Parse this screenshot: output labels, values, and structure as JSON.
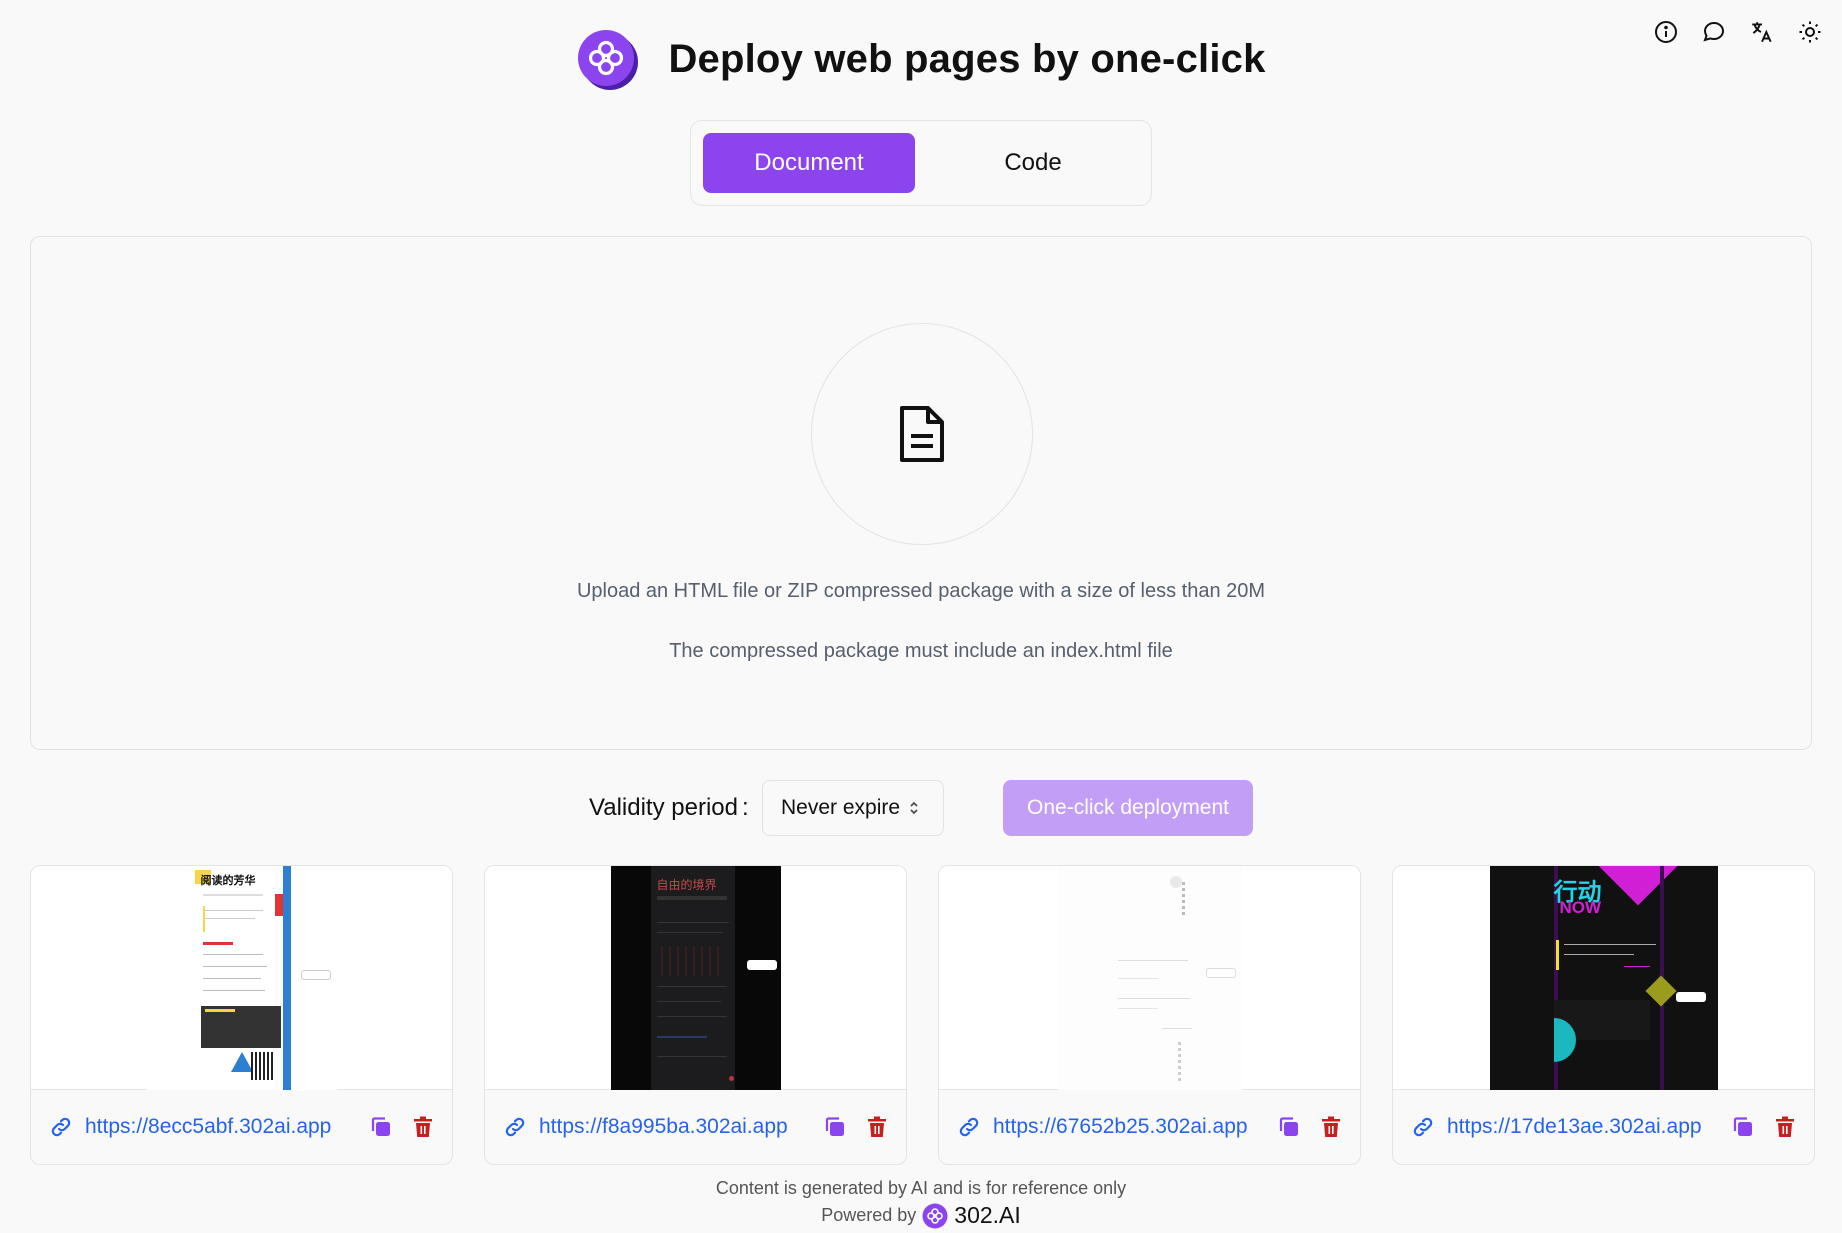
{
  "app": {
    "title": "Deploy web pages by one-click"
  },
  "top_icons": [
    "info-icon",
    "chat-icon",
    "translate-icon",
    "theme-icon"
  ],
  "tabs": [
    {
      "label": "Document",
      "active": true
    },
    {
      "label": "Code",
      "active": false
    }
  ],
  "upload": {
    "line1": "Upload an HTML file or ZIP compressed package with a size of less than 20M",
    "line2": "The compressed package must include an index.html file",
    "icon": "file-text-icon"
  },
  "deploy": {
    "validity_label": "Validity period",
    "validity_colon": ":",
    "validity_value": "Never expire",
    "button_label": "One-click deployment"
  },
  "cards": [
    {
      "url": "https://8ecc5abf.302ai.app",
      "thumb_title": "阅读的芳华"
    },
    {
      "url": "https://f8a995ba.302ai.app",
      "thumb_title": "自由的境界"
    },
    {
      "url": "https://67652b25.302ai.app",
      "thumb_title": ""
    },
    {
      "url": "https://17de13ae.302ai.app",
      "thumb_title": "行动",
      "thumb_subtitle": "NOW"
    }
  ],
  "footer": {
    "disclaimer": "Content is generated by AI and is for reference only",
    "powered_by": "Powered by",
    "brand": "302.AI"
  },
  "colors": {
    "accent": "#8c44ef",
    "accent_disabled": "#c39ef7",
    "link": "#2563eb",
    "delete": "#c81e1e"
  }
}
